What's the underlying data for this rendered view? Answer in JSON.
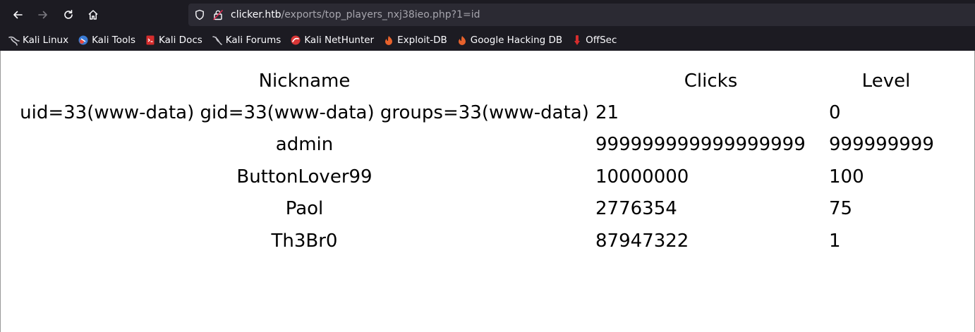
{
  "browser": {
    "url_host": "clicker.htb",
    "url_path": "/exports/top_players_nxj38ieo.php?1=id",
    "icons": [
      "back-icon",
      "forward-icon",
      "reload-icon",
      "home-icon",
      "shield-icon",
      "lock-icon"
    ],
    "bookmarks": [
      {
        "label": "Kali Linux",
        "icon": "kali-dragon-icon"
      },
      {
        "label": "Kali Tools",
        "icon": "kali-tools-icon"
      },
      {
        "label": "Kali Docs",
        "icon": "kali-docs-icon"
      },
      {
        "label": "Kali Forums",
        "icon": "kali-forums-icon"
      },
      {
        "label": "Kali NetHunter",
        "icon": "nethunter-icon"
      },
      {
        "label": "Exploit-DB",
        "icon": "exploitdb-icon"
      },
      {
        "label": "Google Hacking DB",
        "icon": "ghdb-icon"
      },
      {
        "label": "OffSec",
        "icon": "offsec-icon"
      }
    ]
  },
  "table": {
    "headers": [
      "Nickname",
      "Clicks",
      "Level"
    ],
    "rows": [
      [
        "uid=33(www-data) gid=33(www-data) groups=33(www-data)",
        "21",
        "0"
      ],
      [
        "admin",
        "999999999999999999",
        "999999999"
      ],
      [
        "ButtonLover99",
        "10000000",
        "100"
      ],
      [
        "Paol",
        "2776354",
        "75"
      ],
      [
        "Th3Br0",
        "87947322",
        "1"
      ]
    ]
  },
  "colors": {
    "chrome_bg": "#1c1b22",
    "urlbar_bg": "#2b2a33",
    "chrome_text": "#fbfbfe",
    "url_path_text": "#a6a5ad"
  }
}
